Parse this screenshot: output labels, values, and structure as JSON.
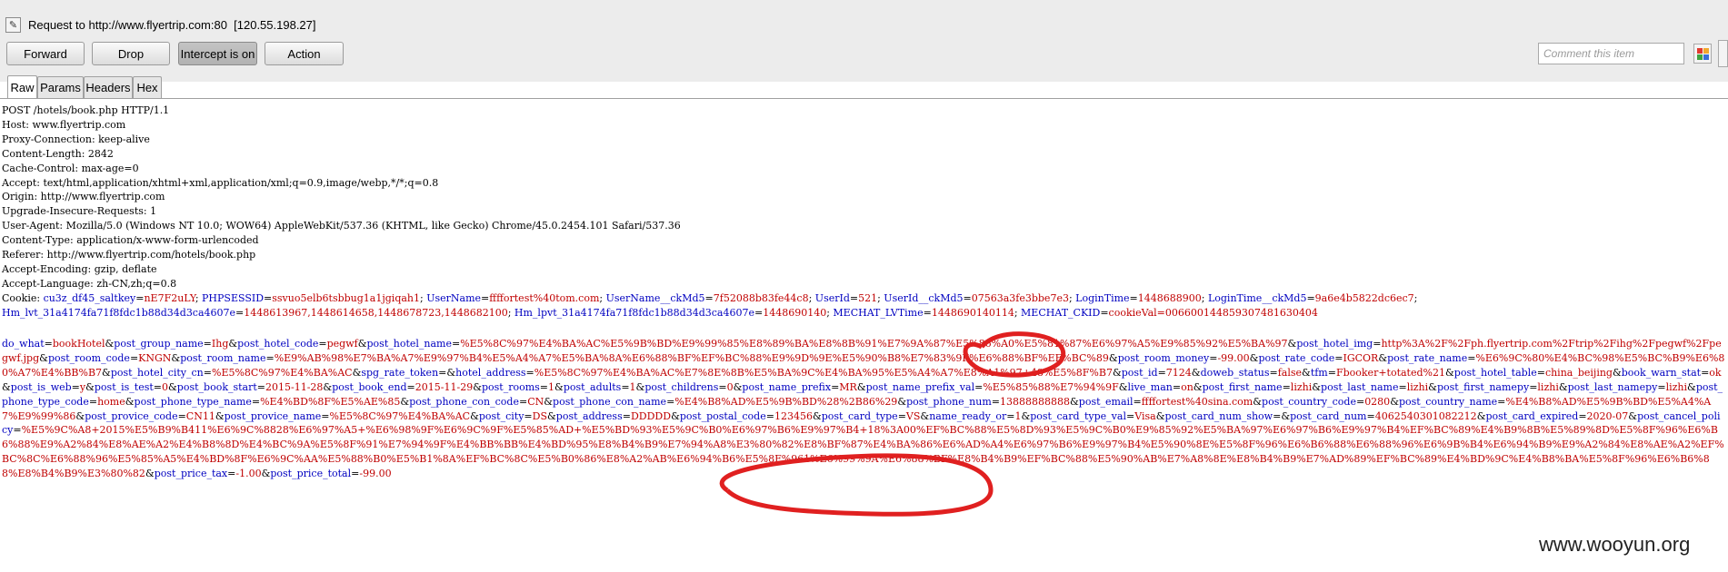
{
  "request_line": "Request to http://www.flyertrip.com:80  [120.55.198.27]",
  "buttons": {
    "forward": "Forward",
    "drop": "Drop",
    "intercept": "Intercept is on",
    "action": "Action"
  },
  "comment_placeholder": "Comment this item",
  "tabs": [
    "Raw",
    "Params",
    "Headers",
    "Hex"
  ],
  "http_header_lines": [
    "POST /hotels/book.php HTTP/1.1",
    "Host: www.flyertrip.com",
    "Proxy-Connection: keep-alive",
    "Content-Length: 2842",
    "Cache-Control: max-age=0",
    "Accept: text/html,application/xhtml+xml,application/xml;q=0.9,image/webp,*/*;q=0.8",
    "Origin: http://www.flyertrip.com",
    "Upgrade-Insecure-Requests: 1",
    "User-Agent: Mozilla/5.0 (Windows NT 10.0; WOW64) AppleWebKit/537.36 (KHTML, like Gecko) Chrome/45.0.2454.101 Safari/537.36",
    "Content-Type: application/x-www-form-urlencoded",
    "Referer: http://www.flyertrip.com/hotels/book.php",
    "Accept-Encoding: gzip, deflate",
    "Accept-Language: zh-CN,zh;q=0.8"
  ],
  "cookie_label": "Cookie: ",
  "cookies": [
    [
      "cu3z_df45_saltkey",
      "nE7F2uLY"
    ],
    [
      "PHPSESSID",
      "ssvuo5elb6tsbbug1a1jgiqah1"
    ],
    [
      "UserName",
      "ffffortest%40tom.com"
    ],
    [
      "UserName__ckMd5",
      "7f52088b83fe44c8"
    ],
    [
      "UserId",
      "521"
    ],
    [
      "UserId__ckMd5",
      "07563a3fe3bbe7e3"
    ],
    [
      "LoginTime",
      "1448688900"
    ],
    [
      "LoginTime__ckMd5",
      "9a6e4b5822dc6ec7"
    ],
    [
      "Hm_lvt_31a4174fa71f8fdc1b88d34d3ca4607e",
      "1448613967,1448614658,1448678723,1448682100"
    ],
    [
      "Hm_lpvt_31a4174fa71f8fdc1b88d34d3ca4607e",
      "1448690140"
    ],
    [
      "MECHAT_LVTime",
      "1448690140114"
    ],
    [
      "MECHAT_CKID",
      "cookieVal=006600144859307481630404"
    ]
  ],
  "post_params": [
    [
      "do_what",
      "bookHotel"
    ],
    [
      "post_group_name",
      "Ihg"
    ],
    [
      "post_hotel_code",
      "pegwf"
    ],
    [
      "post_hotel_name",
      "%E5%8C%97%E4%BA%AC%E5%9B%BD%E9%99%85%E8%89%BA%E8%8B%91%E7%9A%87%E5%86%A0%E5%81%87%E6%97%A5%E9%85%92%E5%BA%97"
    ],
    [
      "post_hotel_img",
      "http%3A%2F%2Fph.flyertrip.com%2Ftrip%2Fihg%2Fpegwf%2Fpegwf.jpg"
    ],
    [
      "post_room_code",
      "KNGN"
    ],
    [
      "post_room_name",
      "%E9%AB%98%E7%BA%A7%E9%97%B4%E5%A4%A7%E5%BA%8A%E6%88%BF%EF%BC%88%E9%9D%9E%E5%90%B8%E7%83%9F%E6%88%BF%EF%BC%89"
    ],
    [
      "post_room_money",
      "-99.00"
    ],
    [
      "post_rate_code",
      "IGCOR"
    ],
    [
      "post_rate_name",
      "%E6%9C%80%E4%BC%98%E5%BC%B9%E6%80%A7%E4%BB%B7"
    ],
    [
      "post_hotel_city_cn",
      "%E5%8C%97%E4%BA%AC"
    ],
    [
      "spg_rate_token",
      ""
    ],
    [
      "hotel_address",
      "%E5%8C%97%E4%BA%AC%E7%8E%8B%E5%BA%9C%E4%BA%95%E5%A4%A7%E8%A1%97+48%E5%8F%B7"
    ],
    [
      "post_id",
      "7124"
    ],
    [
      "doweb_status",
      "false"
    ],
    [
      "tfm",
      "Fbooker+totated%21"
    ],
    [
      "post_hotel_table",
      "china_beijing"
    ],
    [
      "book_warn_stat",
      "ok"
    ],
    [
      "post_is_web",
      "y"
    ],
    [
      "post_is_test",
      "0"
    ],
    [
      "post_book_start",
      "2015-11-28"
    ],
    [
      "post_book_end",
      "2015-11-29"
    ],
    [
      "post_rooms",
      "1"
    ],
    [
      "post_adults",
      "1"
    ],
    [
      "post_childrens",
      "0"
    ],
    [
      "post_name_prefix",
      "MR"
    ],
    [
      "post_name_prefix_val",
      "%E5%85%88%E7%94%9F"
    ],
    [
      "live_man",
      "on"
    ],
    [
      "post_first_name",
      "lizhi"
    ],
    [
      "post_last_name",
      "lizhi"
    ],
    [
      "post_first_namepy",
      "lizhi"
    ],
    [
      "post_last_namepy",
      "lizhi"
    ],
    [
      "post_phone_type_code",
      "home"
    ],
    [
      "post_phone_type_name",
      "%E4%BD%8F%E5%AE%85"
    ],
    [
      "post_phone_con_code",
      "CN"
    ],
    [
      "post_phone_con_name",
      "%E4%B8%AD%E5%9B%BD%28%2B86%29"
    ],
    [
      "post_phone_num",
      "13888888888"
    ],
    [
      "post_email",
      "ffffortest%40sina.com"
    ],
    [
      "post_country_code",
      "0280"
    ],
    [
      "post_country_name",
      "%E4%B8%AD%E5%9B%BD%E5%A4%A7%E9%99%86"
    ],
    [
      "post_provice_code",
      "CN11"
    ],
    [
      "post_provice_name",
      "%E5%8C%97%E4%BA%AC"
    ],
    [
      "post_city",
      "DS"
    ],
    [
      "post_address",
      "DDDDD"
    ],
    [
      "post_postal_code",
      "123456"
    ],
    [
      "post_card_type",
      "VS"
    ],
    [
      "name_ready_or",
      "1"
    ],
    [
      "post_card_type_val",
      "Visa"
    ],
    [
      "post_card_num_show",
      ""
    ],
    [
      "post_card_num",
      "4062540301082212"
    ],
    [
      "post_card_expired",
      "2020-07"
    ],
    [
      "post_cancel_policy",
      "%E5%9C%A8+2015%E5%B9%B411%E6%9C%8828%E6%97%A5+%E6%98%9F%E6%9C%9F%E5%85%AD+%E5%BD%93%E5%9C%B0%E6%97%B6%E9%97%B4+18%3A00%EF%BC%88%E5%8D%93%E5%9C%B0%E9%85%92%E5%BA%97%E6%97%B6%E9%97%B4%EF%BC%89%E4%B9%8B%E5%89%8D%E5%8F%96%E6%B6%88%E9%A2%84%E8%AE%A2%E4%B8%8D%E4%BC%9A%E5%8F%91%E7%94%9F%E4%BB%BB%E4%BD%95%E8%B4%B9%E7%94%A8%E3%80%82%E8%BF%87%E4%BA%86%E6%AD%A4%E6%97%B6%E9%97%B4%E5%90%8E%E5%8F%96%E6%B6%88%E6%88%96%E6%9B%B4%E6%94%B9%E9%A2%84%E8%AE%A2%EF%BC%8C%E6%88%96%E5%85%A5%E4%BD%8F%E6%9C%AA%E5%88%B0%E5%B1%8A%EF%BC%8C%E5%B0%86%E8%A2%AB%E6%94%B6%E5%8F%961%E6%99%9A%E6%88%BF%E8%B4%B9%EF%BC%88%E5%90%AB%E7%A8%8E%E8%B4%B9%E7%AD%89%EF%BC%89%E4%BD%9C%E4%B8%BA%E5%8F%96%E6%B6%88%E8%B4%B9%E3%80%82"
    ],
    [
      "post_price_tax",
      "-1.00"
    ],
    [
      "post_price_total",
      "-99.00"
    ]
  ],
  "watermark": "www.wooyun.org",
  "colors": {
    "param_key": "#0000c0",
    "param_value": "#c00000",
    "annotation": "#e02020"
  }
}
